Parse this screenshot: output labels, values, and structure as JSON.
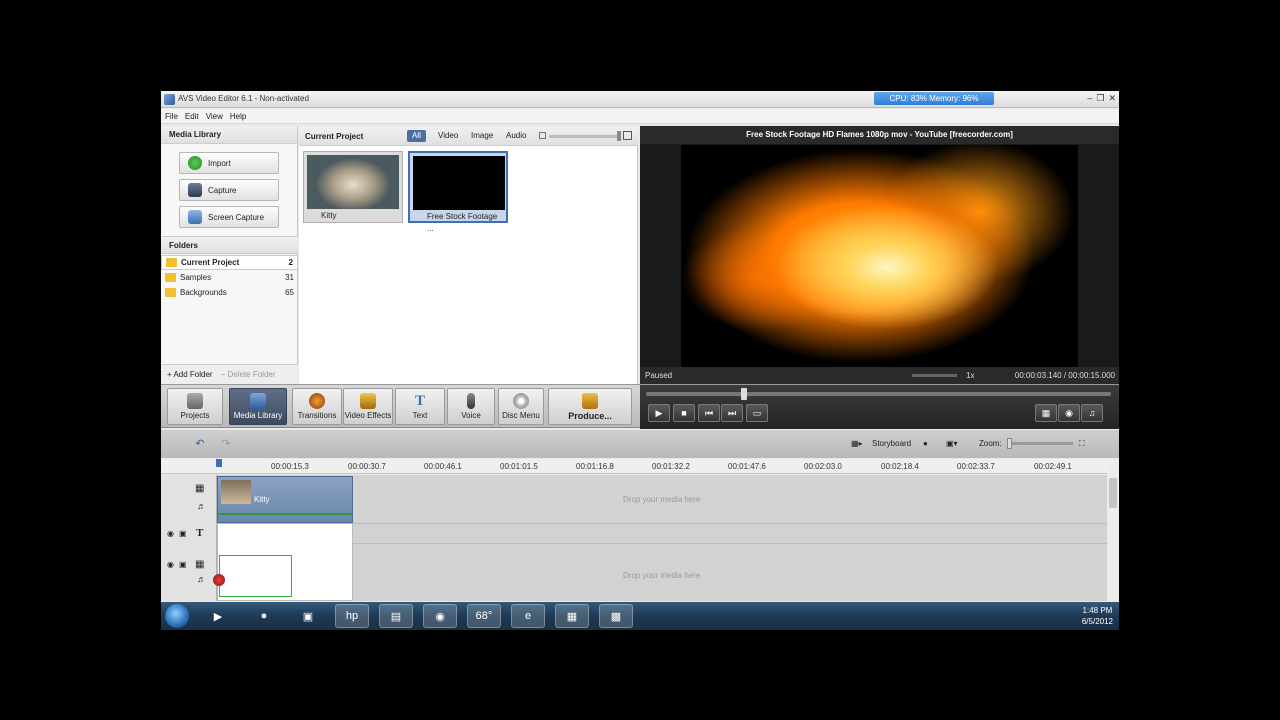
{
  "app": {
    "title": "AVS Video Editor 6.1 - Non-activated",
    "status": "CPU: 83%   Memory: 96%"
  },
  "menu": [
    "File",
    "Edit",
    "View",
    "Help"
  ],
  "library": {
    "header": "Media Library",
    "buttons": {
      "import": "Import",
      "capture": "Capture",
      "screen_capture": "Screen Capture"
    },
    "folders_header": "Folders",
    "folders": [
      {
        "name": "Current Project",
        "count": "2"
      },
      {
        "name": "Samples",
        "count": "31"
      },
      {
        "name": "Backgrounds",
        "count": "65"
      }
    ],
    "add_folder": "Add Folder",
    "delete_folder": "Delete Folder"
  },
  "project": {
    "header": "Current Project",
    "filters": [
      "All",
      "Video",
      "Image",
      "Audio"
    ],
    "items": [
      {
        "label": "Kitty"
      },
      {
        "label": "Free Stock Footage ..."
      }
    ]
  },
  "preview": {
    "title": "Free Stock Footage HD Flames 1080p mov - YouTube [freecorder.com]",
    "status": "Paused",
    "speed": "1x",
    "time": "00:00:03.140 / 00:00:15.000"
  },
  "toolbar": {
    "projects": "Projects",
    "media_library": "Media Library",
    "transitions": "Transitions",
    "video_effects": "Video Effects",
    "text": "Text",
    "voice": "Voice",
    "disc_menu": "Disc Menu",
    "produce": "Produce..."
  },
  "timeline": {
    "storyboard": "Storyboard",
    "zoom": "Zoom:",
    "ruler": [
      "00:00:15.3",
      "00:00:30.7",
      "00:00:46.1",
      "00:01:01.5",
      "00:01:16.8",
      "00:01:32.2",
      "00:01:47.6",
      "00:02:03.0",
      "00:02:18.4",
      "00:02:33.7",
      "00:02:49.1"
    ],
    "clip_name": "Kitty",
    "drop_hint": "Drop your media here"
  },
  "taskbar": {
    "weather": "68°",
    "time": "1:48 PM",
    "date": "6/5/2012"
  }
}
